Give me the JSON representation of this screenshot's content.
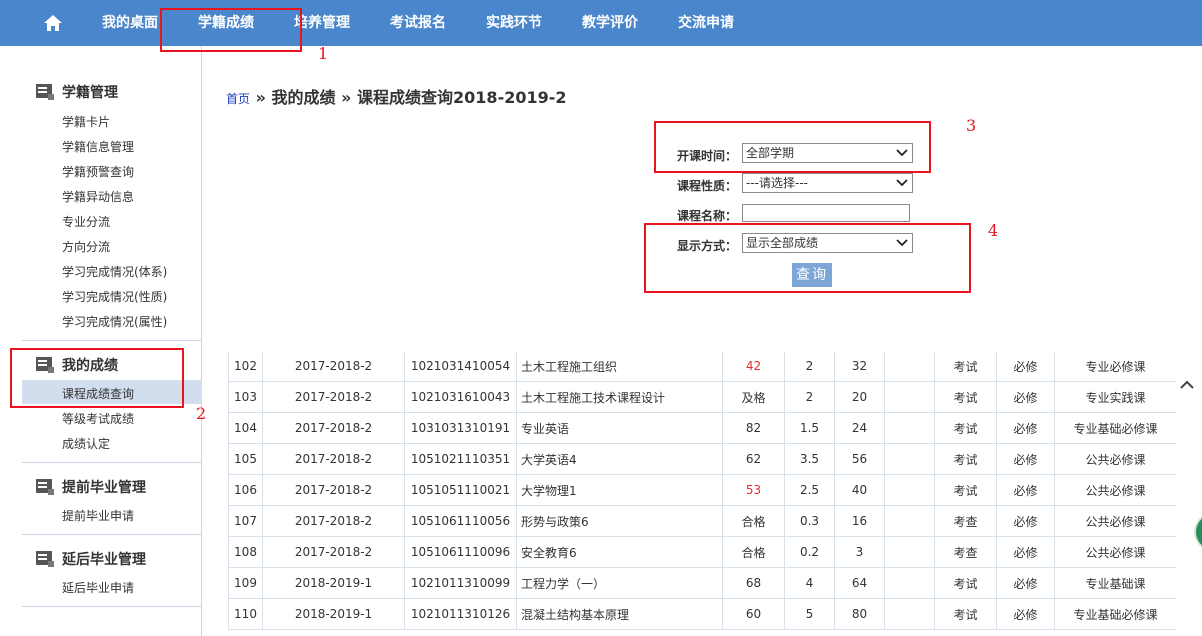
{
  "nav": {
    "home_icon": "home-icon",
    "items": [
      "我的桌面",
      "学籍成绩",
      "培养管理",
      "考试报名",
      "实践环节",
      "教学评价",
      "交流申请"
    ]
  },
  "annotations": [
    "1",
    "2",
    "3",
    "4"
  ],
  "sidebar": {
    "groups": [
      {
        "title": "学籍管理",
        "icon": "folder-icon",
        "links": [
          "学籍卡片",
          "学籍信息管理",
          "学籍预警查询",
          "学籍异动信息",
          "专业分流",
          "方向分流",
          "学习完成情况(体系)",
          "学习完成情况(性质)",
          "学习完成情况(属性)"
        ]
      },
      {
        "title": "我的成绩",
        "icon": "folder-icon",
        "links": [
          "课程成绩查询",
          "等级考试成绩",
          "成绩认定"
        ]
      },
      {
        "title": "提前毕业管理",
        "icon": "folder-icon",
        "links": [
          "提前毕业申请"
        ]
      },
      {
        "title": "延后毕业管理",
        "icon": "folder-icon",
        "links": [
          "延后毕业申请"
        ]
      }
    ]
  },
  "breadcrumb": {
    "home": "首页",
    "sep": "»",
    "level1": "我的成绩",
    "level2": "课程成绩查询2018-2019-2"
  },
  "form": {
    "term_label": "开课时间：",
    "term_value": "全部学期",
    "nature_label": "课程性质：",
    "nature_value": "---请选择---",
    "name_label": "课程名称：",
    "name_value": "",
    "display_label": "显示方式：",
    "display_value": "显示全部成绩",
    "query_button": "查询"
  },
  "colors": {
    "nav_bg": "#4a86cc",
    "annotation_red": "#e8141e",
    "fail_red": "#e03030",
    "active_bg": "#d2deee"
  },
  "table": {
    "rows": [
      [
        "102",
        "2017-2018-2",
        "1021031410054",
        "土木工程施工组织",
        "42",
        "2",
        "32",
        "",
        "考试",
        "必修",
        "专业必修课"
      ],
      [
        "103",
        "2017-2018-2",
        "1021031610043",
        "土木工程施工技术课程设计",
        "及格",
        "2",
        "20",
        "",
        "考试",
        "必修",
        "专业实践课"
      ],
      [
        "104",
        "2017-2018-2",
        "1031031310191",
        "专业英语",
        "82",
        "1.5",
        "24",
        "",
        "考试",
        "必修",
        "专业基础必修课"
      ],
      [
        "105",
        "2017-2018-2",
        "1051021110351",
        "大学英语4",
        "62",
        "3.5",
        "56",
        "",
        "考试",
        "必修",
        "公共必修课"
      ],
      [
        "106",
        "2017-2018-2",
        "1051051110021",
        "大学物理1",
        "53",
        "2.5",
        "40",
        "",
        "考试",
        "必修",
        "公共必修课"
      ],
      [
        "107",
        "2017-2018-2",
        "1051061110056",
        "形势与政策6",
        "合格",
        "0.3",
        "16",
        "",
        "考查",
        "必修",
        "公共必修课"
      ],
      [
        "108",
        "2017-2018-2",
        "1051061110096",
        "安全教育6",
        "合格",
        "0.2",
        "3",
        "",
        "考查",
        "必修",
        "公共必修课"
      ],
      [
        "109",
        "2018-2019-1",
        "1021011310099",
        "工程力学（一）",
        "68",
        "4",
        "64",
        "",
        "考试",
        "必修",
        "专业基础课"
      ],
      [
        "110",
        "2018-2019-1",
        "1021011310126",
        "混凝土结构基本原理",
        "60",
        "5",
        "80",
        "",
        "考试",
        "必修",
        "专业基础必修课"
      ]
    ],
    "failing_rows": [
      0,
      4
    ]
  }
}
